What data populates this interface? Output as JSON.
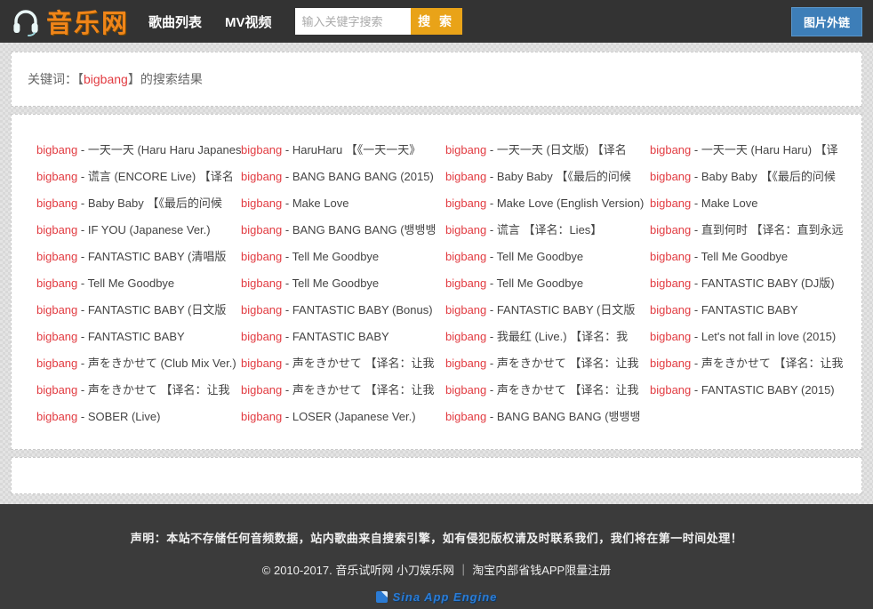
{
  "header": {
    "logo_text": "音乐网",
    "nav": [
      {
        "label": "歌曲列表"
      },
      {
        "label": "MV视频"
      }
    ],
    "search": {
      "placeholder": "输入关键字搜索",
      "value": "",
      "button_label": "搜 索"
    },
    "external_button_label": "图片外链"
  },
  "keyword_bar": {
    "prefix": "关键词：【",
    "keyword": "bigbang",
    "suffix": "】的搜索结果"
  },
  "results": {
    "artist": "bigbang",
    "separator": " - ",
    "columns": [
      [
        "一天一天 (Haru Haru Japanese Ver.)",
        "谎言 (ENCORE Live) 【译名",
        "Baby Baby 【《最后的问候",
        "IF YOU (Japanese Ver.)",
        "FANTASTIC BABY (清唱版",
        "Tell Me Goodbye",
        "FANTASTIC BABY (日文版",
        "FANTASTIC BABY",
        "声をきかせて (Club Mix Ver.)",
        "声をきかせて 【译名：让我",
        "SOBER (Live)"
      ],
      [
        "HaruHaru 【《一天一天》",
        "BANG BANG BANG (2015)",
        "Make Love",
        "BANG BANG BANG (뱅뱅뱅",
        "Tell Me Goodbye",
        "Tell Me Goodbye",
        "FANTASTIC BABY (Bonus)",
        "FANTASTIC BABY",
        "声をきかせて 【译名：让我",
        "声をきかせて 【译名：让我",
        "LOSER (Japanese Ver.)"
      ],
      [
        "一天一天 (日文版) 【译名",
        "Baby Baby 【《最后的问候",
        "Make Love (English Version)",
        "谎言 【译名：Lies】",
        "Tell Me Goodbye",
        "Tell Me Goodbye",
        "FANTASTIC BABY (日文版",
        "我最红 (Live.) 【译名：我",
        "声をきかせて 【译名：让我",
        "声をきかせて 【译名：让我",
        "BANG BANG BANG (뱅뱅뱅"
      ],
      [
        "一天一天 (Haru Haru) 【译",
        "Baby Baby 【《最后的问候",
        "Make Love",
        "直到何时 【译名：直到永远",
        "Tell Me Goodbye",
        "FANTASTIC BABY (DJ版)",
        "FANTASTIC BABY",
        "Let's not fall in love (2015)",
        "声をきかせて 【译名：让我",
        "FANTASTIC BABY (2015)"
      ]
    ]
  },
  "footer": {
    "disclaimer": "声明：本站不存储任何音频数据，站内歌曲来自搜索引擎，如有侵犯版权请及时联系我们，我们将在第一时间处理！",
    "copyright": "© 2010-2017. 音乐试听网 小刀娱乐网 ｜ 淘宝内部省钱APP限量注册",
    "platform_logo_text": "Sina App Engine"
  },
  "colors": {
    "header_bg": "#333333",
    "logo_orange": "#f08519",
    "artist_red": "#e23b41",
    "search_button_orange": "#e9a318",
    "external_button_blue": "#3d7eb8",
    "footer_bg": "#3b3b3b",
    "sae_blue": "#2b7bd4"
  }
}
